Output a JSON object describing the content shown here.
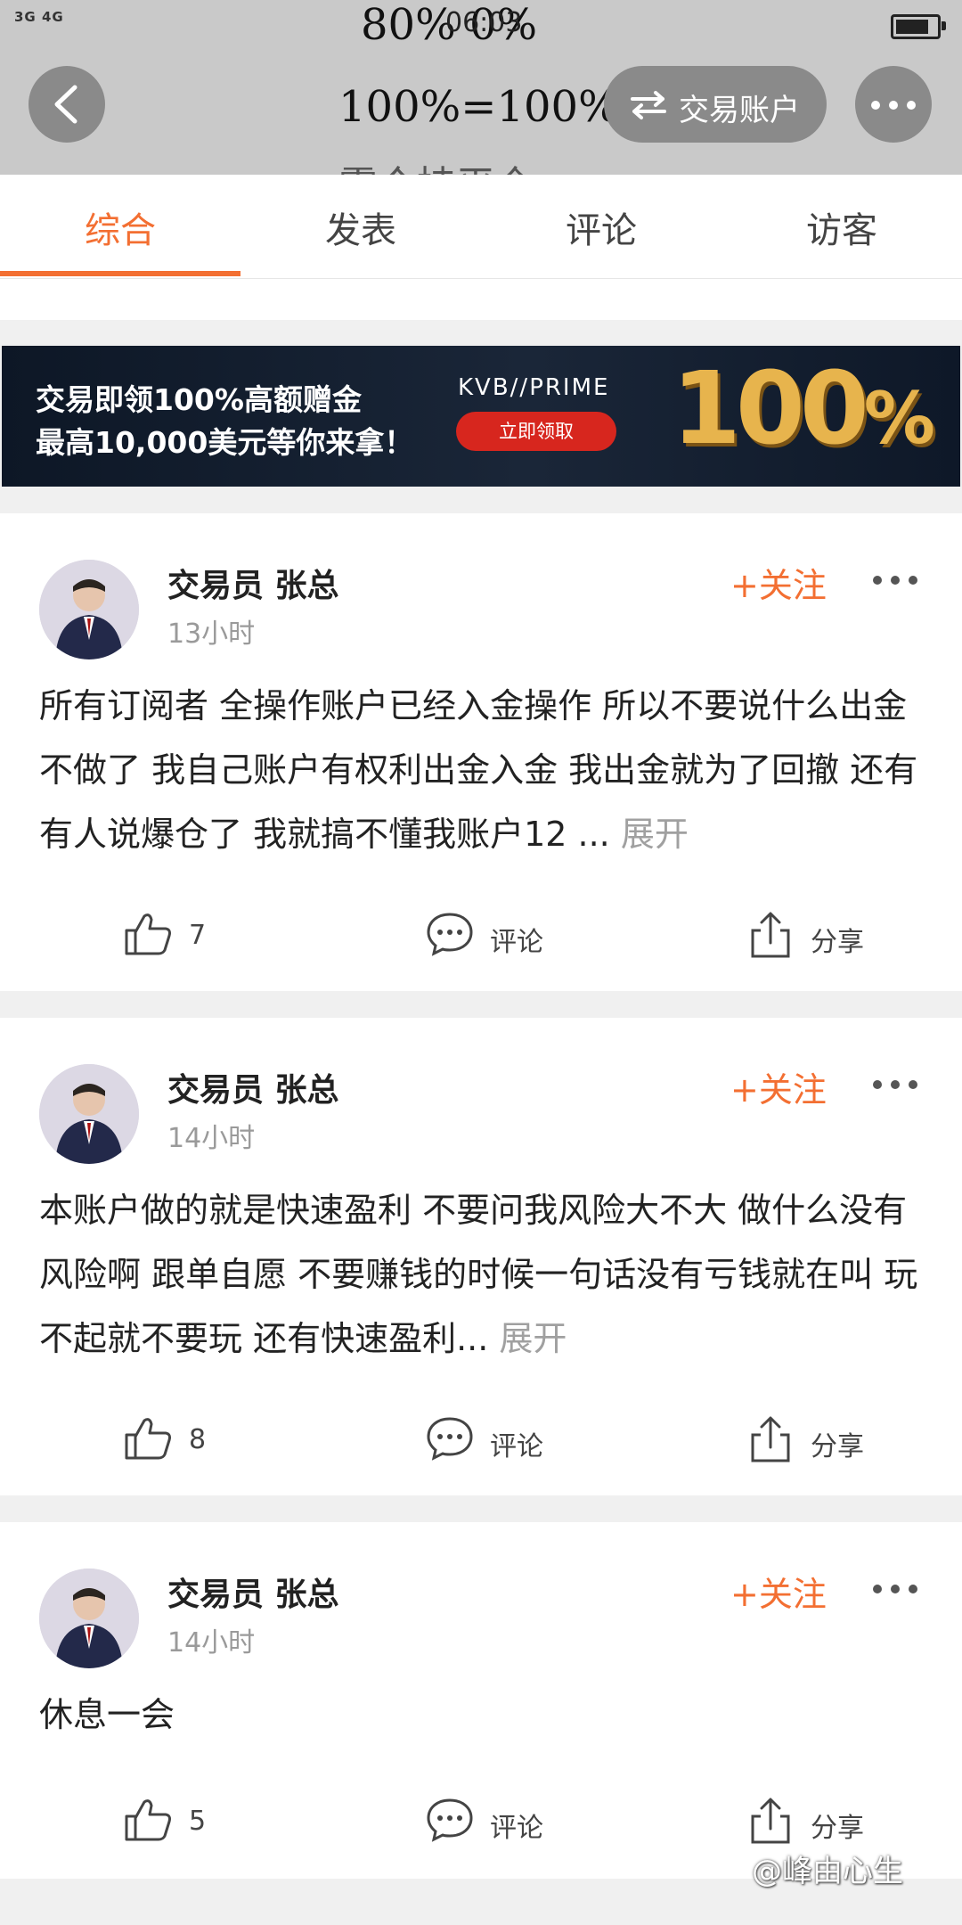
{
  "status_bar": {
    "signal": "3G 4G",
    "time": "06:03",
    "overlay_text": "80% 0%"
  },
  "header": {
    "title": "100%=100%",
    "ghost_text": "零个持平仓",
    "account_button": "交易账户"
  },
  "tabs": [
    "综合",
    "发表",
    "评论",
    "访客"
  ],
  "active_tab": 0,
  "banner": {
    "line1": "交易即领100%高额赠金",
    "line2": "最高10,000美元等你来拿！",
    "brand": "KVB//PRIME",
    "cta": "立即领取",
    "big_number": "100",
    "big_suffix": "%"
  },
  "posts": [
    {
      "username": "交易员  张总",
      "time": "13小时",
      "follow": "+关注",
      "content": "所有订阅者 全操作账户已经入金操作 所以不要说什么出金不做了 我自己账户有权利出金入金 我出金就为了回撤 还有有人说爆仓了 我就搞不懂我账户12 ...",
      "expand": "展开",
      "likes": "7",
      "comment": "评论",
      "share": "分享"
    },
    {
      "username": "交易员  张总",
      "time": "14小时",
      "follow": "+关注",
      "content": " 本账户做的就是快速盈利 不要问我风险大不大 做什么没有风险啊 跟单自愿 不要赚钱的时候一句话没有亏钱就在叫  玩不起就不要玩 还有快速盈利...",
      "expand": "展开",
      "likes": "8",
      "comment": "评论",
      "share": "分享"
    },
    {
      "username": "交易员  张总",
      "time": "14小时",
      "follow": "+关注",
      "content": "休息一会",
      "expand": "",
      "likes": "5",
      "comment": "评论",
      "share": "分享"
    }
  ],
  "watermark": "@峰由心生",
  "colors": {
    "accent": "#f36f32",
    "header_bg": "#c9c9c9",
    "button_bg": "#8a8a8a"
  }
}
